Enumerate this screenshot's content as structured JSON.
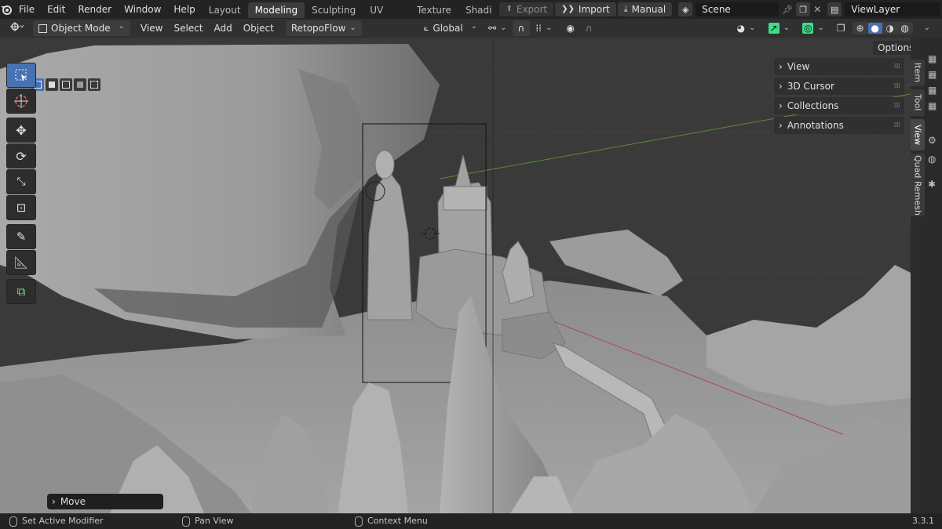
{
  "topbar": {
    "menus": [
      "File",
      "Edit",
      "Render",
      "Window",
      "Help"
    ],
    "workspaces": [
      "Layout",
      "Modeling",
      "Sculpting",
      "UV Editing",
      "Texture Paint",
      "Shadi"
    ],
    "active_workspace": "Modeling",
    "export_label": "Export",
    "import_label": "Import",
    "manual_label": "Manual",
    "scene_name": "Scene",
    "view_layer_name": "ViewLayer"
  },
  "header": {
    "mode": "Object Mode",
    "menus": [
      "View",
      "Select",
      "Add",
      "Object"
    ],
    "addon_menu": "RetopoFlow",
    "orientation": "Global"
  },
  "viewport": {
    "options_label": "Options",
    "operator_panel_label": "Move"
  },
  "npanel": {
    "sections": [
      "View",
      "3D Cursor",
      "Collections",
      "Annotations"
    ]
  },
  "sidebar_tabs": [
    "Item",
    "Tool",
    "View",
    "Quad Remesh"
  ],
  "active_sidebar_tab": "View",
  "statusbar": {
    "left": "Set Active Modifier",
    "middle": "Pan View",
    "right": "Context Menu",
    "version": "3.3.1"
  },
  "colors": {
    "accent": "#4772b3",
    "gizmo_green": "#3fdc8a",
    "x_axis": "#b04a4a",
    "y_axis": "#5c8a3a"
  }
}
